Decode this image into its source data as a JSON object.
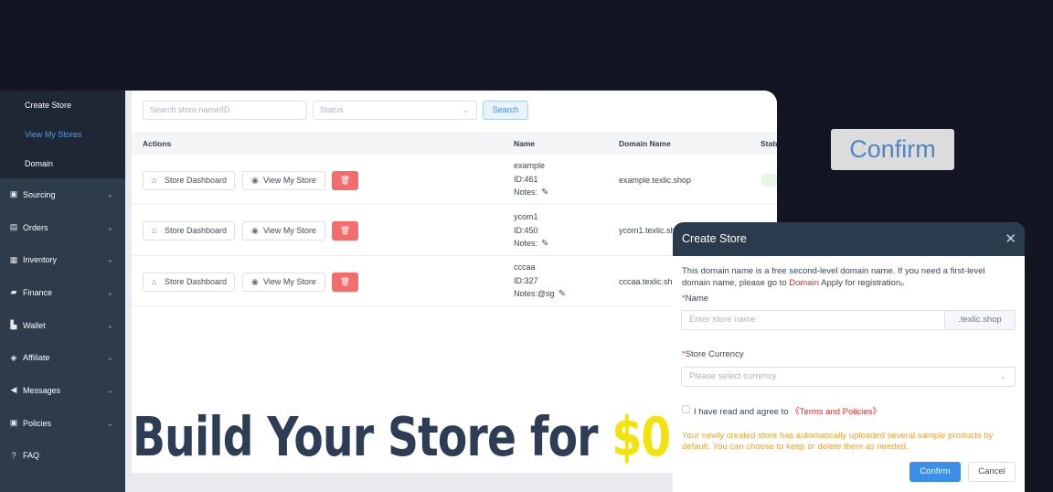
{
  "sidebar": {
    "submenu": [
      {
        "label": "Create Store"
      },
      {
        "label": "View My Stores"
      },
      {
        "label": "Domain"
      }
    ],
    "items": [
      {
        "label": "Sourcing",
        "icon": "box-icon"
      },
      {
        "label": "Orders",
        "icon": "orders-icon"
      },
      {
        "label": "Inventory",
        "icon": "inventory-icon"
      },
      {
        "label": "Finance",
        "icon": "finance-icon"
      },
      {
        "label": "Wallet",
        "icon": "wallet-icon"
      },
      {
        "label": "Affiliate",
        "icon": "affiliate-icon"
      },
      {
        "label": "Messages",
        "icon": "megaphone-icon"
      },
      {
        "label": "Policies",
        "icon": "policies-icon"
      },
      {
        "label": "FAQ",
        "icon": "question-icon"
      }
    ]
  },
  "filters": {
    "search_placeholder": "Search store name/ID",
    "status_placeholder": "Status",
    "search_button": "Search"
  },
  "table": {
    "headers": {
      "actions": "Actions",
      "name": "Name",
      "domain": "Domain Name",
      "status": "Statu"
    },
    "action_labels": {
      "dashboard": "Store Dashboard",
      "view": "View My Store"
    },
    "rows": [
      {
        "name": "example",
        "id": "ID:461",
        "notes": "Notes:",
        "domain": "example.texlic.shop"
      },
      {
        "name": "ycom1",
        "id": "ID:450",
        "notes": "Notes:",
        "domain": "ycom1.texlic.sh"
      },
      {
        "name": "cccaa",
        "id": "ID:327",
        "notes": "Notes:@sg",
        "domain": "cccaa.texlic.sh"
      }
    ]
  },
  "headline": {
    "text": "Build Your Store for ",
    "highlight": "$0"
  },
  "floating_button": "Confirm",
  "modal": {
    "title": "Create Store",
    "info_before": "This domain name is a free second-level domain name. If you need a first-level domain name, please go to ",
    "info_link": "Domain",
    "info_after": " Apply for registration。",
    "name_label": "Name",
    "name_placeholder": "Enter store name",
    "name_suffix": ".texlic.shop",
    "currency_label": "Store Currency",
    "currency_placeholder": "Please select currency",
    "agree_text": "I have read and agree to ",
    "agree_link": "《Terms and Policies》",
    "notice": "Your newly created store has automatically uploaded several sample products by default. You can choose to keep or delete them as needed.",
    "confirm": "Confirm",
    "cancel": "Cancel"
  },
  "colors": {
    "accent": "#3d8ee6",
    "danger": "#f56c6c",
    "headline": "#2c3d55",
    "highlight": "#f4e20d"
  }
}
